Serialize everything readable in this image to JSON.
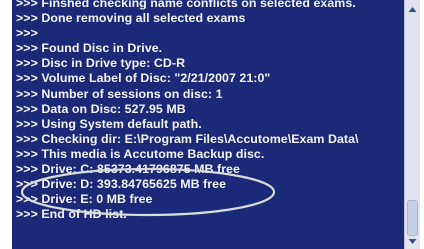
{
  "log": {
    "lines": [
      ">>> Finshed checking name conflicts on selected exams.",
      ">>> Done removing all selected exams",
      ">>>",
      ">>> Found Disc in Drive.",
      ">>> Disc in Drive type: CD-R",
      ">>> Volume Label of Disc: \"2/21/2007 21:0\"",
      ">>> Number of sessions on disc: 1",
      ">>> Data on Disc: 527.95 MB",
      ">>> Using System default path.",
      ">>> Checking dir: E:\\Program Files\\Accutome\\Exam Data\\",
      ">>> This media is Accutome Backup disc.",
      ">>> Drive: C: 85373.41796875 MB free",
      ">>> Drive: D: 393.84765625 MB free",
      ">>> Drive: E: 0 MB free",
      ">>> End of HD list."
    ]
  },
  "colors": {
    "panel_background": "#1b2a78",
    "text": "#f4f4f4",
    "highlight_ring": "#d9d9d9"
  },
  "icons": {
    "scroll_up": "arrow-up-icon",
    "scroll_down": "arrow-down-icon"
  }
}
